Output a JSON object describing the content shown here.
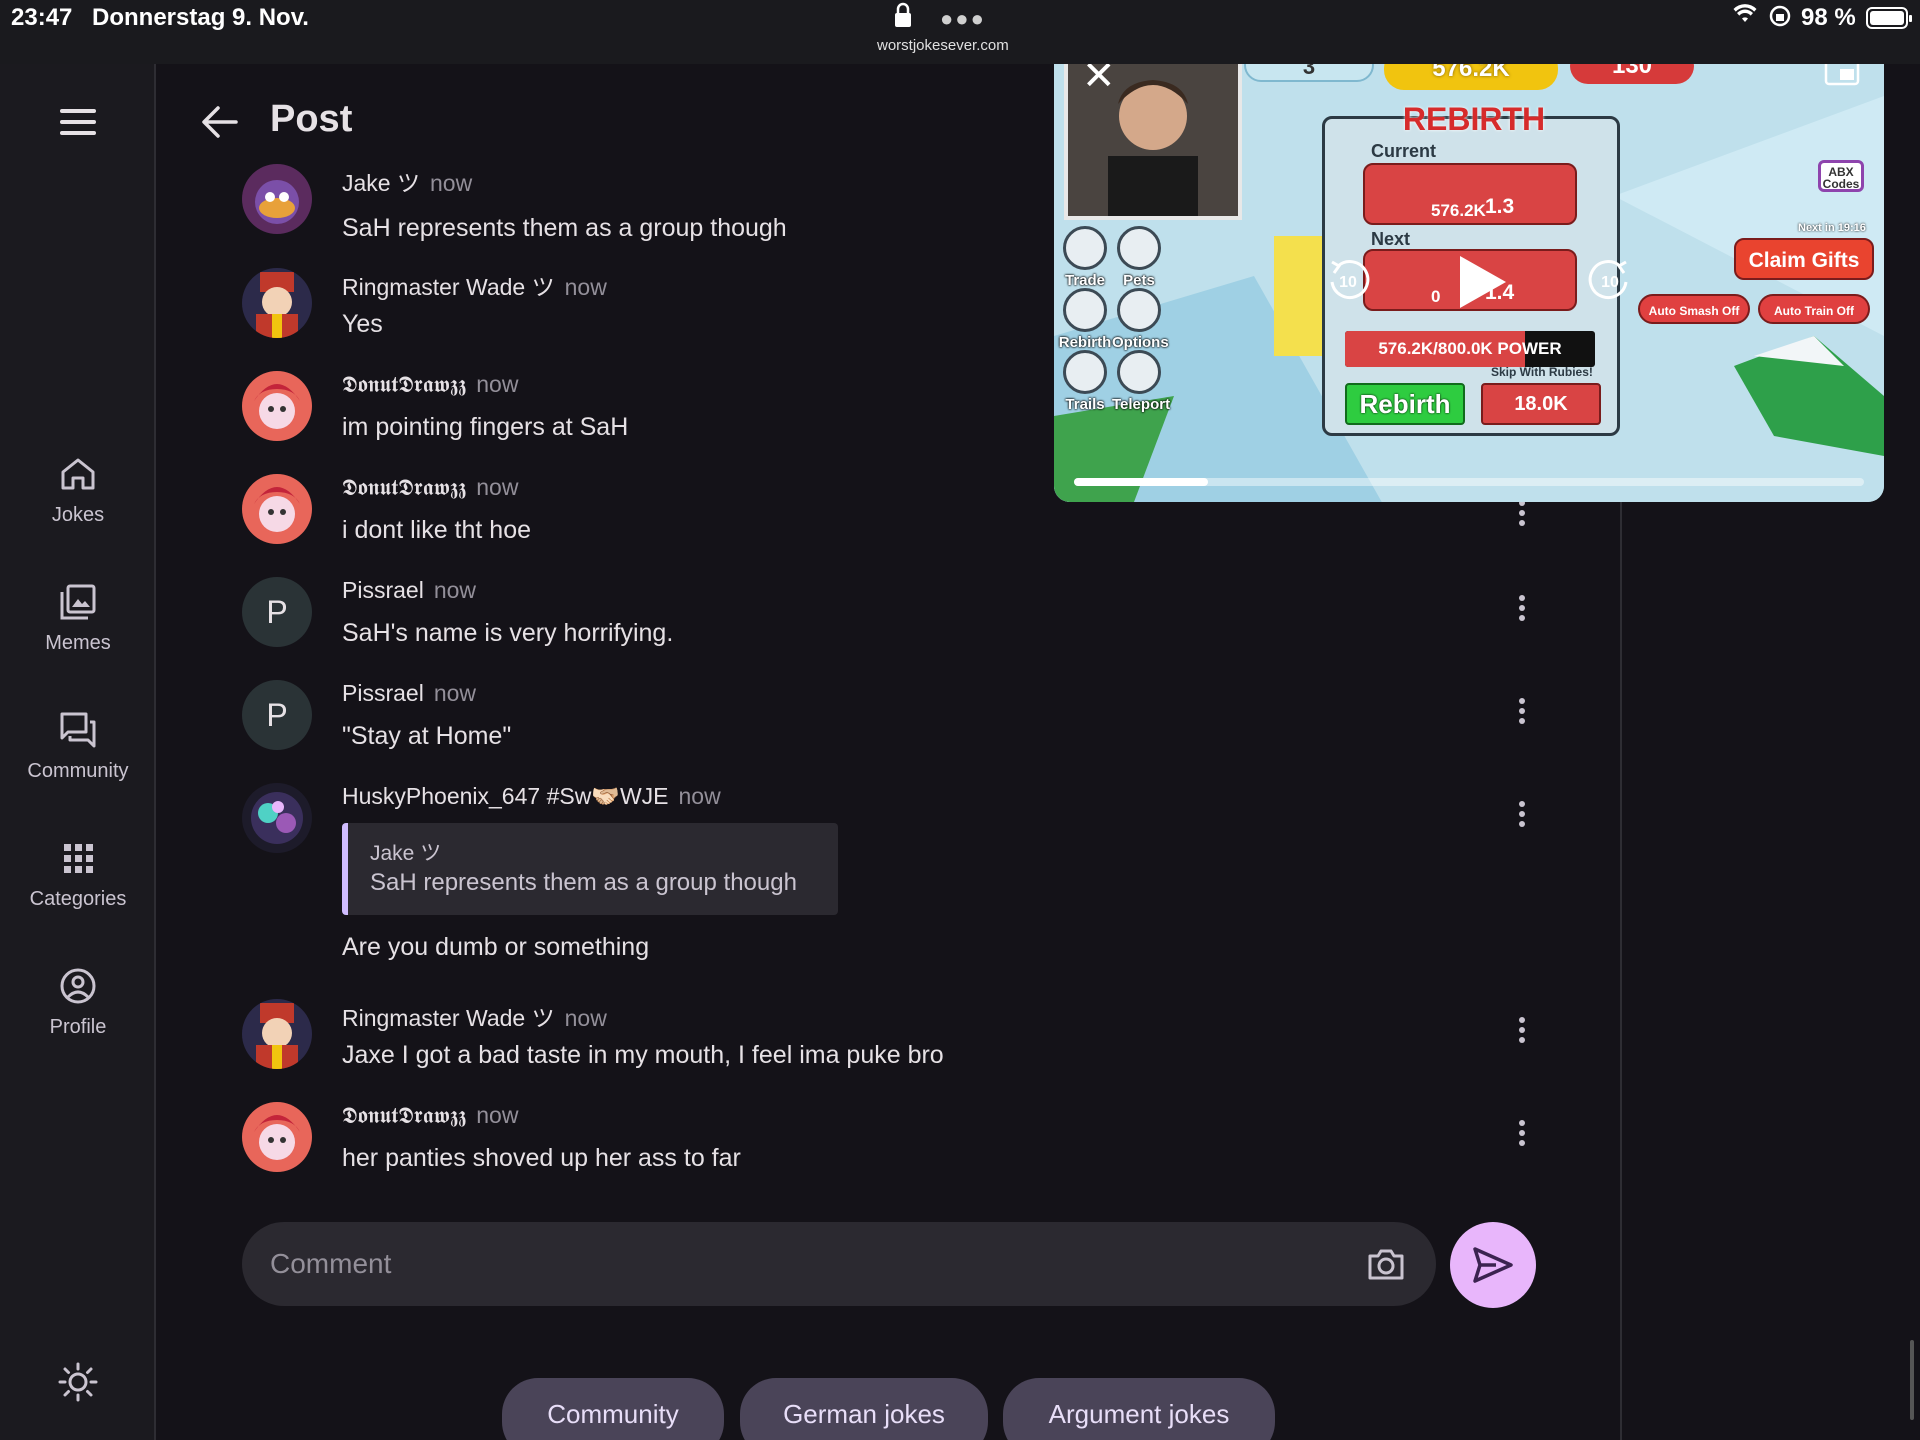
{
  "status_bar": {
    "time": "23:47",
    "date": "Donnerstag 9. Nov.",
    "url": "worstjokesever.com",
    "battery": "98 %"
  },
  "nav": {
    "items": [
      {
        "label": "Jokes",
        "icon": "home-icon"
      },
      {
        "label": "Memes",
        "icon": "gallery-icon"
      },
      {
        "label": "Community",
        "icon": "forum-icon"
      },
      {
        "label": "Categories",
        "icon": "apps-grid-icon"
      },
      {
        "label": "Profile",
        "icon": "account-circle-icon"
      }
    ]
  },
  "header": {
    "title": "Post"
  },
  "comments": [
    {
      "author": "Jake ツ",
      "time": "now",
      "text": "SaH represents them as a group though"
    },
    {
      "author": "Ringmaster Wade ツ",
      "time": "now",
      "text": "Yes"
    },
    {
      "author": "𝕯𝖔𝖓𝖚𝖙𝕯𝖗𝖆𝖜𝖟𝖟",
      "time": "now",
      "text": "im pointing fingers at SaH"
    },
    {
      "author": "𝕯𝖔𝖓𝖚𝖙𝕯𝖗𝖆𝖜𝖟𝖟",
      "time": "now",
      "text": "i dont like tht hoe"
    },
    {
      "author": "Pissrael",
      "time": "now",
      "text": "SaH's name is very horrifying.",
      "avatar_letter": "P"
    },
    {
      "author": "Pissrael",
      "time": "now",
      "text": "\"Stay at Home\"",
      "avatar_letter": "P"
    },
    {
      "author": "HuskyPhoenix_647 #Sw🫱🏻‍🫲🏼WJE",
      "time": "now",
      "text": "Are you dumb or something",
      "reply": {
        "author": "Jake ツ",
        "text": "SaH represents them as a group though"
      }
    },
    {
      "author": "Ringmaster Wade ツ",
      "time": "now",
      "text": "Jaxe I got a bad taste in my mouth, I feel ima puke bro"
    },
    {
      "author": "𝕯𝖔𝖓𝖚𝖙𝕯𝖗𝖆𝖜𝖟𝖟",
      "time": "now",
      "text": "her panties shoved up her ass to far"
    }
  ],
  "comment_input": {
    "placeholder": "Comment"
  },
  "chips": [
    "Community",
    "German jokes",
    "Argument jokes"
  ],
  "pip_video": {
    "playback_progress": 0.17,
    "game": {
      "coins": "576.2K",
      "count": "3",
      "gems": "130",
      "rebirth_title": "REBIRTH",
      "current_label": "Current",
      "current_power": "576.2K",
      "current_mult": "1.3",
      "next_label": "Next",
      "next_power": "0",
      "next_mult": "1.4",
      "power_text": "576.2K/800.0K POWER",
      "power_fraction": 0.72,
      "rebirth_button": "Rebirth",
      "skip_label": "Skip With Rubies!",
      "skip_cost": "18.0K",
      "side_buttons": [
        "Trade",
        "Pets",
        "Rebirth",
        "Options",
        "Trails",
        "Teleport"
      ],
      "claim_gifts": "Claim Gifts",
      "next_in": "Next in 19:16",
      "auto_smash": "Auto Smash Off",
      "auto_train": "Auto Train Off",
      "codes_top": "ABX",
      "codes_bottom": "Codes",
      "skip_seconds": "10"
    }
  },
  "colors": {
    "background": "#141218",
    "accent": "#e8b6fb",
    "chip_bg": "#4a4458",
    "quote_border": "#d0bcff"
  }
}
